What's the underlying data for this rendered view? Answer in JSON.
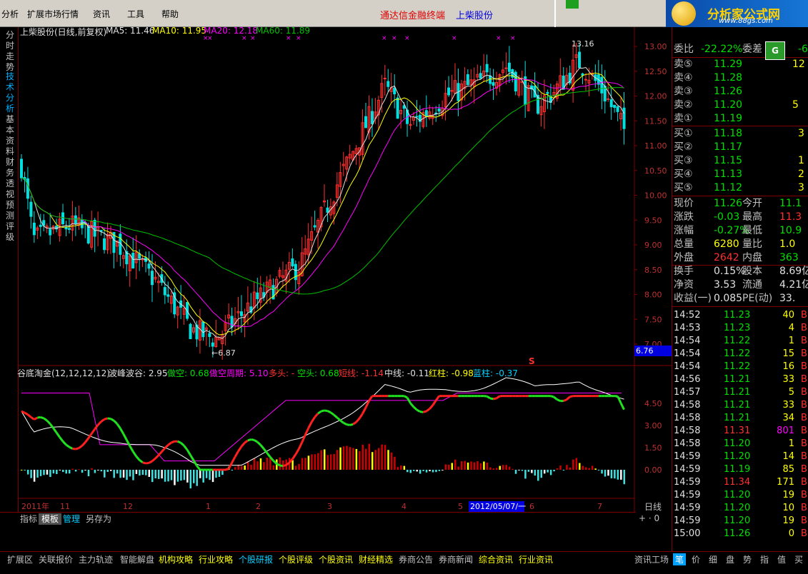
{
  "menu": {
    "items": [
      "分析",
      "扩展市场行情",
      "资讯",
      "工具",
      "帮助"
    ],
    "terminal_title": "通达信金融终端",
    "stock_title": "上柴股份"
  },
  "logo": {
    "name": "分析家公式网",
    "url": "www.88gs.com"
  },
  "left_tabs": [
    {
      "label": "分时走势",
      "active": false
    },
    {
      "label": "技术分析",
      "active": true
    },
    {
      "label": "基本资料",
      "active": false
    },
    {
      "label": "财务透视",
      "active": false
    },
    {
      "label": "预测评级",
      "active": false
    }
  ],
  "main_chart": {
    "title": "上柴股份(日线,前复权)",
    "ma_labels": [
      {
        "text": "MA5: 11.46",
        "color": "#e0e0e0"
      },
      {
        "text": "MA10: 11.95",
        "color": "#ffff00"
      },
      {
        "text": "MA20: 12.18",
        "color": "#ff00ff"
      },
      {
        "text": "MA60: 11.89",
        "color": "#00c000"
      }
    ],
    "y_ticks": [
      "13.00",
      "12.50",
      "12.00",
      "11.50",
      "11.00",
      "10.50",
      "10.00",
      "9.50",
      "9.00",
      "8.50",
      "8.00",
      "7.50",
      "7.00"
    ],
    "high_label": "13.16",
    "low_label": "6.87",
    "cursor_value": "6.76",
    "signal_char": "S"
  },
  "indicator": {
    "name": "谷底淘金(12,12,12,12)",
    "params": [
      {
        "text": "波峰波谷: 2.95",
        "color": "#e0e0e0"
      },
      {
        "text": "做空: 0.68",
        "color": "#00e000"
      },
      {
        "text": "做空周期: 5.10",
        "color": "#ff00ff"
      },
      {
        "text": "多头: -",
        "color": "#ff3030"
      },
      {
        "text": "空头: 0.68",
        "color": "#00e000"
      },
      {
        "text": "短线: -1.14",
        "color": "#ff3030"
      },
      {
        "text": "中线: -0.11",
        "color": "#e0e0e0"
      },
      {
        "text": "红柱: -0.98",
        "color": "#ffff00"
      },
      {
        "text": "蓝柱: -0.37",
        "color": "#00d0ff"
      }
    ],
    "y_ticks": [
      "4.50",
      "3.00",
      "1.50",
      "0.00"
    ]
  },
  "x_axis": {
    "labels": [
      "2011年",
      "11",
      "12",
      "1",
      "2",
      "3",
      "4",
      "5",
      "6",
      "7"
    ],
    "cursor_date": "2012/05/07/一"
  },
  "sub_toolbar": [
    "指标",
    "模板",
    "管理",
    "另存为"
  ],
  "period_label": "日线",
  "zoom_controls": "+ · 0",
  "quote": {
    "weibi_label": "委比",
    "weibi_value": "-22.22%",
    "weicha_label": "委差",
    "weicha_value": "-6",
    "sell": [
      {
        "label": "卖⑤",
        "price": "11.29",
        "vol": "12"
      },
      {
        "label": "卖④",
        "price": "11.28",
        "vol": ""
      },
      {
        "label": "卖③",
        "price": "11.26",
        "vol": ""
      },
      {
        "label": "卖②",
        "price": "11.20",
        "vol": "5"
      },
      {
        "label": "卖①",
        "price": "11.19",
        "vol": ""
      }
    ],
    "buy": [
      {
        "label": "买①",
        "price": "11.18",
        "vol": "3"
      },
      {
        "label": "买②",
        "price": "11.17",
        "vol": ""
      },
      {
        "label": "买③",
        "price": "11.15",
        "vol": "1"
      },
      {
        "label": "买④",
        "price": "11.13",
        "vol": "2"
      },
      {
        "label": "买⑤",
        "price": "11.12",
        "vol": "3"
      }
    ],
    "stats": [
      {
        "l1": "现价",
        "v1": "11.26",
        "c1": "dn",
        "l2": "今开",
        "v2": "11.1",
        "c2": "dn"
      },
      {
        "l1": "涨跌",
        "v1": "-0.03",
        "c1": "dn",
        "l2": "最高",
        "v2": "11.3",
        "c2": "up"
      },
      {
        "l1": "涨幅",
        "v1": "-0.27%",
        "c1": "dn",
        "l2": "最低",
        "v2": "10.9",
        "c2": "dn"
      },
      {
        "l1": "总量",
        "v1": "6280",
        "c1": "yl",
        "l2": "量比",
        "v2": "1.0",
        "c2": "yl"
      },
      {
        "l1": "外盘",
        "v1": "2642",
        "c1": "up",
        "l2": "内盘",
        "v2": "363",
        "c2": "dn"
      },
      {
        "l1": "换手",
        "v1": "0.15%",
        "c1": "wh",
        "l2": "股本",
        "v2": "8.69亿",
        "c2": "wh"
      },
      {
        "l1": "净资",
        "v1": "3.53",
        "c1": "wh",
        "l2": "流通",
        "v2": "4.21亿",
        "c2": "wh"
      },
      {
        "l1": "收益(一)",
        "v1": "0.085",
        "c1": "wh",
        "l2": "PE(动)",
        "v2": "33.",
        "c2": "wh"
      }
    ],
    "ticks": [
      {
        "time": "14:52",
        "price": "11.23",
        "pc": "dn",
        "vol": "40",
        "vc": "yl"
      },
      {
        "time": "14:53",
        "price": "11.23",
        "pc": "dn",
        "vol": "4",
        "vc": "yl"
      },
      {
        "time": "14:54",
        "price": "11.22",
        "pc": "dn",
        "vol": "1",
        "vc": "yl"
      },
      {
        "time": "14:54",
        "price": "11.22",
        "pc": "dn",
        "vol": "15",
        "vc": "yl"
      },
      {
        "time": "14:54",
        "price": "11.22",
        "pc": "dn",
        "vol": "16",
        "vc": "yl"
      },
      {
        "time": "14:56",
        "price": "11.21",
        "pc": "dn",
        "vol": "33",
        "vc": "yl"
      },
      {
        "time": "14:57",
        "price": "11.21",
        "pc": "dn",
        "vol": "5",
        "vc": "yl"
      },
      {
        "time": "14:58",
        "price": "11.21",
        "pc": "dn",
        "vol": "33",
        "vc": "yl"
      },
      {
        "time": "14:58",
        "price": "11.21",
        "pc": "dn",
        "vol": "34",
        "vc": "yl"
      },
      {
        "time": "14:58",
        "price": "11.31",
        "pc": "up",
        "vol": "801",
        "vc": "mg"
      },
      {
        "time": "14:58",
        "price": "11.20",
        "pc": "dn",
        "vol": "1",
        "vc": "yl"
      },
      {
        "time": "14:59",
        "price": "11.20",
        "pc": "dn",
        "vol": "14",
        "vc": "yl"
      },
      {
        "time": "14:59",
        "price": "11.19",
        "pc": "dn",
        "vol": "85",
        "vc": "yl"
      },
      {
        "time": "14:59",
        "price": "11.34",
        "pc": "up",
        "vol": "171",
        "vc": "yl"
      },
      {
        "time": "14:59",
        "price": "11.20",
        "pc": "dn",
        "vol": "19",
        "vc": "yl"
      },
      {
        "time": "14:59",
        "price": "11.20",
        "pc": "dn",
        "vol": "10",
        "vc": "yl"
      },
      {
        "time": "14:59",
        "price": "11.20",
        "pc": "dn",
        "vol": "19",
        "vc": "yl"
      },
      {
        "time": "15:00",
        "price": "11.26",
        "pc": "dn",
        "vol": "0",
        "vc": "yl"
      }
    ]
  },
  "bottom_tabs": [
    {
      "label": "扩展区",
      "style": ""
    },
    {
      "label": "关联报价",
      "style": ""
    },
    {
      "label": "主力轨迹",
      "style": ""
    },
    {
      "label": "智能解盘",
      "style": ""
    },
    {
      "label": "机构攻略",
      "style": "yl"
    },
    {
      "label": "行业攻略",
      "style": "yl"
    },
    {
      "label": "个股研报",
      "style": "cy"
    },
    {
      "label": "个股评级",
      "style": "yl"
    },
    {
      "label": "个股资讯",
      "style": "yl"
    },
    {
      "label": "财经精选",
      "style": "yl"
    },
    {
      "label": "券商公告",
      "style": ""
    },
    {
      "label": "券商新闻",
      "style": ""
    },
    {
      "label": "综合资讯",
      "style": "yl"
    },
    {
      "label": "行业资讯",
      "style": "yl"
    }
  ],
  "right_tabs": [
    {
      "label": "资讯工场",
      "active": false
    },
    {
      "label": "笔",
      "active": true
    },
    {
      "label": "价",
      "active": false
    },
    {
      "label": "细",
      "active": false
    },
    {
      "label": "盘",
      "active": false
    },
    {
      "label": "势",
      "active": false
    },
    {
      "label": "指",
      "active": false
    },
    {
      "label": "值",
      "active": false
    },
    {
      "label": "买",
      "active": false
    }
  ],
  "colors": {
    "up": "#ff3030",
    "down": "#00e0e0",
    "ma5": "#e0e0e0",
    "ma10": "#ffff00",
    "ma20": "#ff00ff",
    "ma60": "#00c000"
  }
}
